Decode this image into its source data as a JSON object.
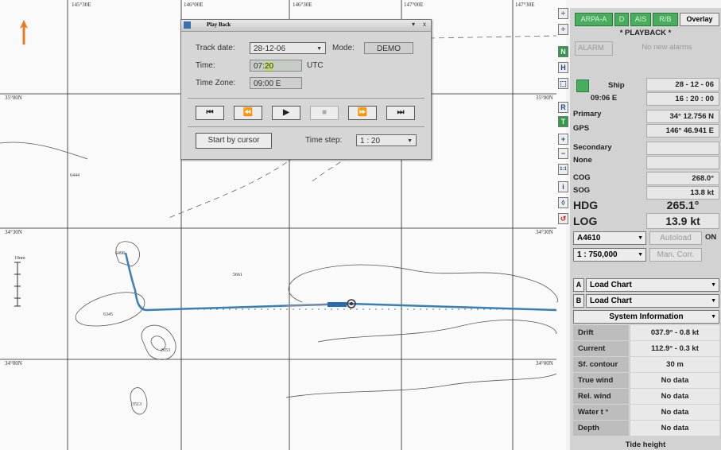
{
  "chart": {
    "lon_labels": [
      "145°30E",
      "146°00E",
      "146°30E",
      "147°00E",
      "147°30E"
    ],
    "lat_labels_left": [
      "35°00N",
      "34°30N",
      "34°00N"
    ],
    "lat_labels_right": [
      "35°00N",
      "34°30N",
      "34°00N"
    ],
    "depths": [
      "6444",
      "6498",
      "5661",
      "6345",
      "2653",
      "3513"
    ],
    "scale_label": "10nm"
  },
  "playback": {
    "title": "Play Back",
    "track_date_label": "Track date:",
    "track_date_value": "28-12-06",
    "mode_label": "Mode:",
    "mode_value": "DEMO",
    "time_label": "Time:",
    "time_hour": "07:",
    "time_min": "20",
    "time_unit": "UTC",
    "timezone_label": "Time Zone:",
    "timezone_value": "09:00 E",
    "controls": [
      "⏮",
      "⏪",
      "▶",
      "■",
      "⏩",
      "⏭"
    ],
    "start_by_cursor": "Start by cursor",
    "time_step_label": "Time step:",
    "time_step_value": "1 : 20"
  },
  "toolbar": [
    "÷",
    "N",
    "H",
    "⬚",
    "R",
    "T",
    "+",
    "−",
    "1:1",
    "i",
    "◊",
    "↺"
  ],
  "panel": {
    "arpa": "ARPA-A",
    "b1": "D",
    "ais": "AIS",
    "rb": "R/B",
    "overlay": "Overlay",
    "playback": "* PLAYBACK *",
    "alarm": "ALARM",
    "no_alarms": "No new alarms",
    "ship_label": "Ship",
    "ship_tz": "09:06 E",
    "date": "28 - 12 - 06",
    "time": "16 : 20 : 00",
    "primary": "Primary",
    "gps": "GPS",
    "lat": "34° 12.756 N",
    "lon": "146° 46.941 E",
    "secondary": "Secondary",
    "none": "None",
    "cog_label": "COG",
    "cog": "268.0°",
    "sog_label": "SOG",
    "sog": "13.8 kt",
    "hdg_label": "HDG",
    "hdg": "265.1°",
    "log_label": "LOG",
    "log": "13.9 kt",
    "chart_id": "A4610",
    "autoload": "Autoload",
    "on": "ON",
    "scale": "1 : 750,000",
    "man_corr": "Man. Corr.",
    "a": "A",
    "b": "B",
    "load_chart": "Load Chart",
    "sysinfo": "System Information",
    "rows": [
      {
        "label": "Drift",
        "value": "037.9° - 0.8 kt"
      },
      {
        "label": "Current",
        "value": "112.9° - 0.3 kt"
      },
      {
        "label": "Sf. contour",
        "value": "30 m"
      },
      {
        "label": "True wind",
        "value": "No data"
      },
      {
        "label": "Rel. wind",
        "value": "No data"
      },
      {
        "label": "Water t °",
        "value": "No data"
      },
      {
        "label": "Depth",
        "value": "No data"
      }
    ],
    "tide": "Tide height"
  }
}
